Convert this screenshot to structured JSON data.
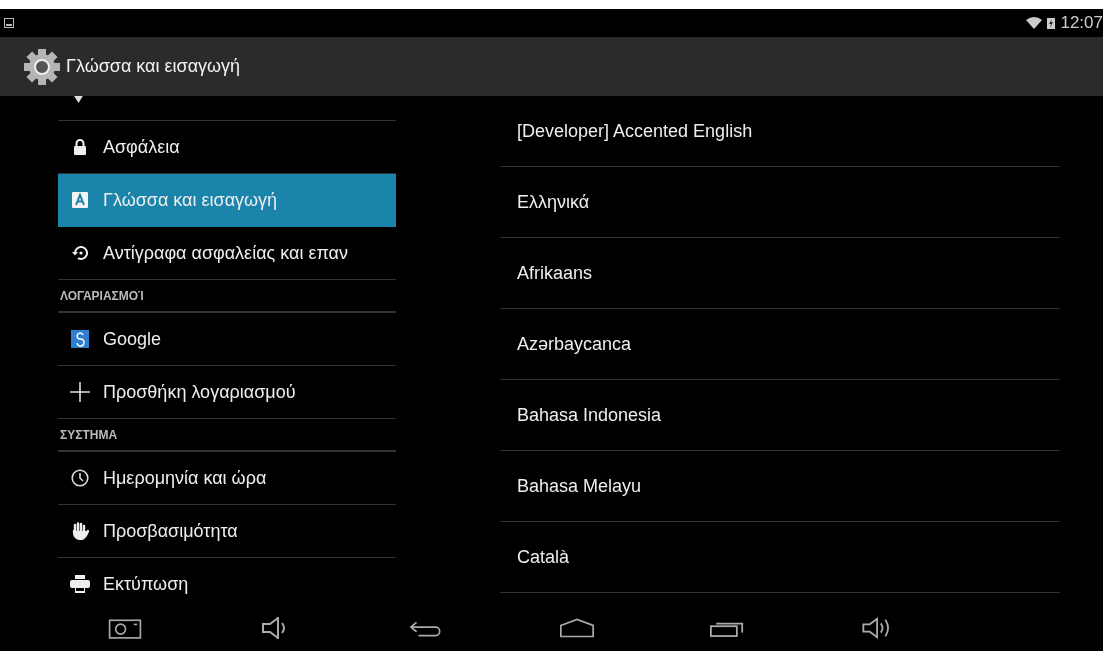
{
  "status_bar": {
    "time": "12:07"
  },
  "action_bar": {
    "title": "Γλώσσα και εισαγωγή"
  },
  "settings_list": [
    {
      "kind": "item",
      "label": "Ασφάλεια",
      "selected": false
    },
    {
      "kind": "item",
      "label": "Γλώσσα και εισαγωγή",
      "selected": true
    },
    {
      "kind": "item",
      "label": "Αντίγραφα ασφαλείας και επαν",
      "selected": false
    },
    {
      "kind": "header",
      "label": "ΛΟΓΑΡΙΑΣΜΟΊ"
    },
    {
      "kind": "item",
      "label": "Google",
      "selected": false
    },
    {
      "kind": "item",
      "label": "Προσθήκη λογαριασμού",
      "selected": false
    },
    {
      "kind": "header",
      "label": "ΣΥΣΤΗΜΑ"
    },
    {
      "kind": "item",
      "label": "Ημερομηνία και ώρα",
      "selected": false
    },
    {
      "kind": "item",
      "label": "Προσβασιμότητα",
      "selected": false
    },
    {
      "kind": "item",
      "label": "Εκτύπωση",
      "selected": false
    }
  ],
  "languages": [
    "[Developer] Accented English",
    "Ελληνικά",
    "Afrikaans",
    "Azərbaycanca",
    "Bahasa Indonesia",
    "Bahasa Melayu",
    "Català"
  ]
}
